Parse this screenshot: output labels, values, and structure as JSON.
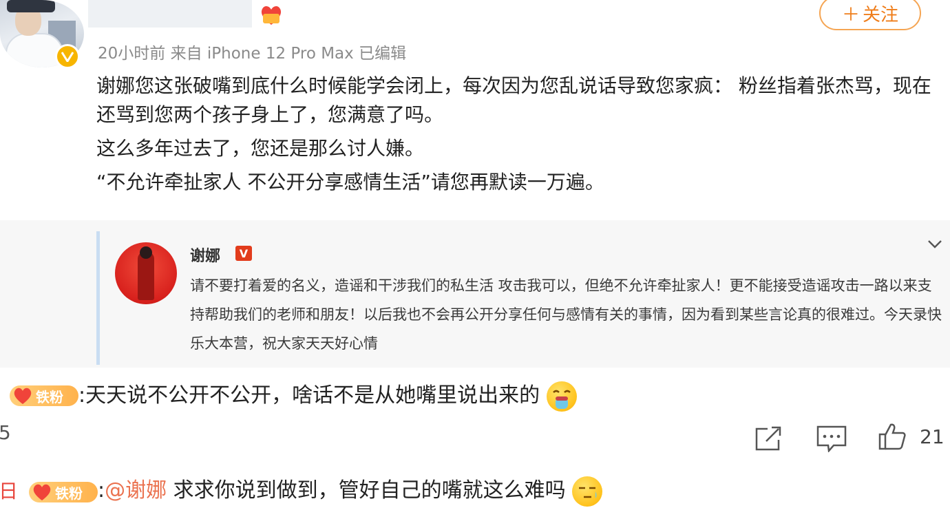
{
  "header": {
    "meta": "20小时前 来自 iPhone 12 Pro Max 已编辑",
    "follow_label": "关注",
    "follow_plus": "＋"
  },
  "post": {
    "paragraphs": [
      "谢娜您这张破嘴到底什么时候能学会闭上，每次因为您乱说话导致您家疯： 粉丝指着张杰骂，现在还骂到您两个孩子身上了，您满意了吗。",
      "这么多年过去了，您还是那么讨人嫌。",
      "“不允许牵扯家人 不公开分享感情生活”请您再默读一万遍。"
    ]
  },
  "quote": {
    "author": "谢娜",
    "verified": "V",
    "text": "请不要打着爱的名义，造谣和干涉我们的私生活 攻击我可以，但绝不允许牵扯家人！更不能接受造谣攻击一路以来支持帮助我们的老师和朋友！以后我也不会再公开分享任何与感情有关的事情，因为看到某些言论真的很难过。今天录快乐大本营，祝大家天天好心情"
  },
  "comments": [
    {
      "badge": "铁粉",
      "separator": ":",
      "text": "天天说不公开不公开，啥话不是从她嘴里说出来的",
      "emoji": "vomit-emoji"
    },
    {
      "badge": "铁粉",
      "separator": ":",
      "mention": "@谢娜",
      "text": " 求求你说到做到，管好自己的嘴就这么难吗",
      "emoji": "speechless-emoji"
    }
  ],
  "actions": {
    "like_count": "21",
    "left_edge_count": "5",
    "left_edge_date": "日"
  },
  "colors": {
    "follow_border": "#f5a553",
    "follow_text": "#ef7d1a",
    "mention": "#eb7350",
    "verified_gold": "#f7b500",
    "quote_bar": "#c9ddf2"
  }
}
